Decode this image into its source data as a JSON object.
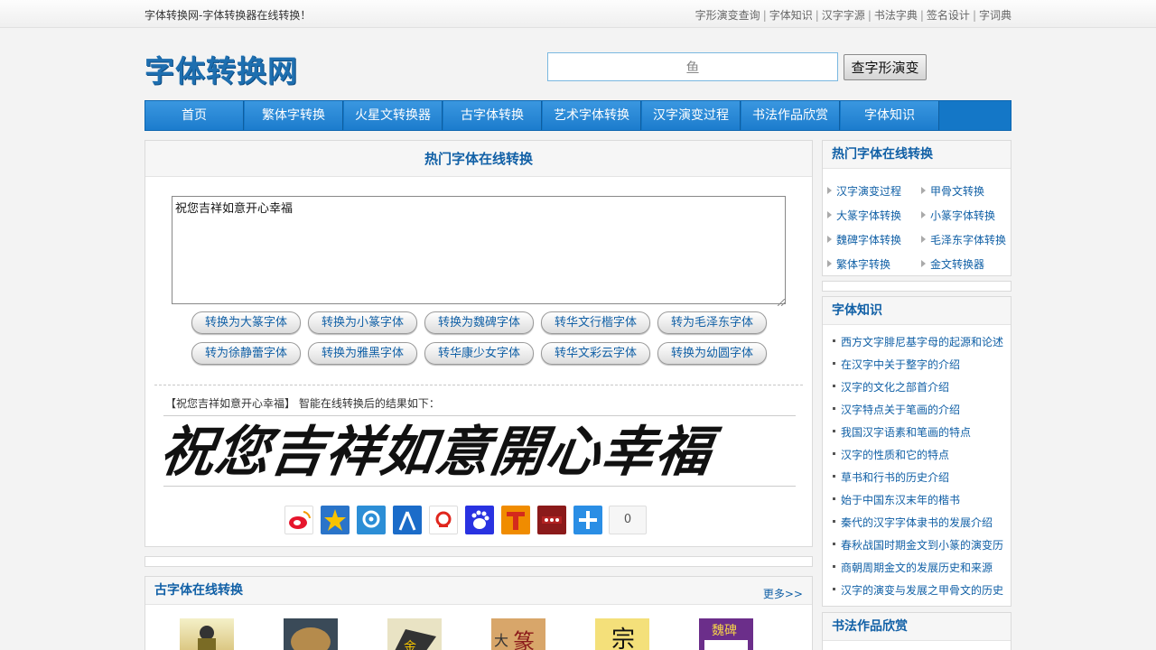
{
  "topbar": {
    "slogan": "字体转换网-字体转换器在线转换！",
    "links": [
      "字形演变查询",
      "字体知识",
      "汉字字源",
      "书法字典",
      "签名设计",
      "字词典"
    ]
  },
  "header": {
    "logo": "字体转换网",
    "search_value": "鱼",
    "search_button": "查字形演变"
  },
  "nav": [
    "首页",
    "繁体字转换",
    "火星文转换器",
    "古字体转换",
    "艺术字体转换",
    "汉字演变过程",
    "书法作品欣赏",
    "字体知识"
  ],
  "main": {
    "title": "热门字体在线转换",
    "input_text": "祝您吉祥如意开心幸福",
    "buttons": [
      "转换为大篆字体",
      "转换为小篆字体",
      "转换为魏碑字体",
      "转华文行楷字体",
      "转为毛泽东字体",
      "转为徐静蕾字体",
      "转换为雅黑字体",
      "转华康少女字体",
      "转华文彩云字体",
      "转换为幼圆字体"
    ],
    "result_prefix": "【祝您吉祥如意开心幸福】",
    "result_suffix": "智能在线转换后的结果如下：",
    "result_text": "祝您吉祥如意開心幸福",
    "share_count": "0",
    "share_icons": [
      "weibo-icon",
      "qzone-icon",
      "tencent-weibo-icon",
      "renren-icon",
      "sohu-icon",
      "baidu-icon",
      "tianya-icon",
      "kaixin-icon",
      "more-share-icon"
    ],
    "share_colors": [
      "#e6162d",
      "#f7c200",
      "#2c8ed6",
      "#1b6cc9",
      "#e0261d",
      "#2932e1",
      "#f08c00",
      "#8b1a1a",
      "#2a8ee5"
    ]
  },
  "gu": {
    "title": "古字体在线转换",
    "more": "更多>>"
  },
  "sidebar": {
    "hot_title": "热门字体在线转换",
    "hot_links": [
      "汉字演变过程",
      "甲骨文转换",
      "大篆字体转换",
      "小篆字体转换",
      "魏碑字体转换",
      "毛泽东字体转换",
      "繁体字转换",
      "金文转换器"
    ],
    "know_title": "字体知识",
    "know_links": [
      "西方文字腓尼基字母的起源和论述",
      "在汉字中关于整字的介绍",
      "汉字的文化之部首介绍",
      "汉字特点关于笔画的介绍",
      "我国汉字语素和笔画的特点",
      "汉字的性质和它的特点",
      "草书和行书的历史介绍",
      "始于中国东汉末年的楷书",
      "秦代的汉字字体隶书的发展介绍",
      "春秋战国时期金文到小篆的演变历",
      "商朝周期金文的发展历史和来源",
      "汉字的演变与发展之甲骨文的历史"
    ],
    "art_title": "书法作品欣赏"
  }
}
